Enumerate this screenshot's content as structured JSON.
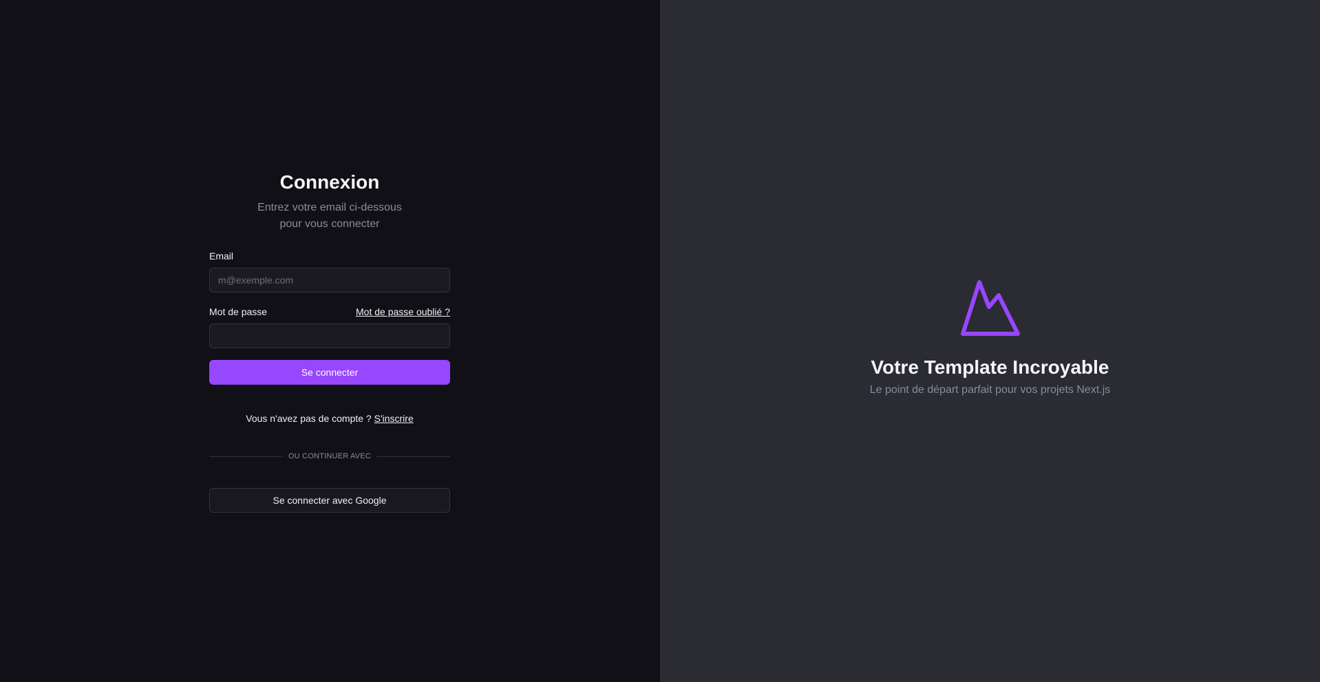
{
  "login": {
    "title": "Connexion",
    "subtitle": "Entrez votre email ci-dessous pour vous connecter",
    "email_label": "Email",
    "email_placeholder": "m@exemple.com",
    "email_value": "",
    "password_label": "Mot de passe",
    "password_value": "",
    "forgot_link": "Mot de passe oublié ?",
    "submit_label": "Se connecter",
    "no_account_text": "Vous n'avez pas de compte ?",
    "signup_link": "S'inscrire",
    "divider_text": "OU CONTINUER AVEC",
    "google_button_label": "Se connecter avec Google"
  },
  "brand": {
    "logo_icon": "mountain-logo-icon",
    "title": "Votre Template Incroyable",
    "subtitle": "Le point de départ parfait pour vos projets Next.js"
  },
  "colors": {
    "left_background": "#101016",
    "right_background": "#2b2b33",
    "accent": "#9747ff",
    "muted_text": "#8b8b9e"
  }
}
